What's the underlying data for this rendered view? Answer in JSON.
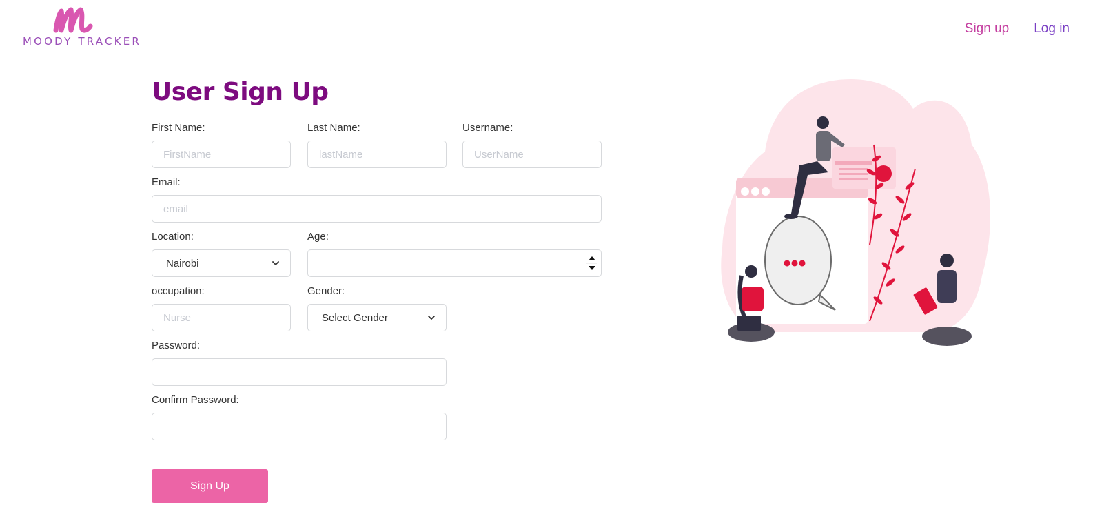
{
  "brand": {
    "name": "MOODY TRACKER",
    "mark": "m"
  },
  "nav": {
    "signup": "Sign up",
    "login": "Log in"
  },
  "form": {
    "title": "User Sign Up",
    "first_name": {
      "label": "First Name:",
      "placeholder": "FirstName",
      "value": ""
    },
    "last_name": {
      "label": "Last Name:",
      "placeholder": "lastName",
      "value": ""
    },
    "username": {
      "label": "Username:",
      "placeholder": "UserName",
      "value": ""
    },
    "email": {
      "label": "Email:",
      "placeholder": "email",
      "value": ""
    },
    "location": {
      "label": "Location:",
      "selected": "Nairobi"
    },
    "age": {
      "label": "Age:",
      "value": ""
    },
    "occupation": {
      "label": "occupation:",
      "placeholder": "Nurse",
      "value": ""
    },
    "gender": {
      "label": "Gender:",
      "selected": "Select Gender"
    },
    "password": {
      "label": "Password:",
      "value": ""
    },
    "confirm_password": {
      "label": "Confirm Password:",
      "value": ""
    },
    "submit": "Sign Up"
  },
  "colors": {
    "title": "#7d0b7f",
    "button": "#ec64a6",
    "signup_link": "#c43fa0",
    "login_link": "#7a3fc4",
    "illustration_bg": "#fde4ea",
    "accent_red": "#e0143c"
  },
  "illustration": {
    "icon": "people-chat-illustration"
  }
}
